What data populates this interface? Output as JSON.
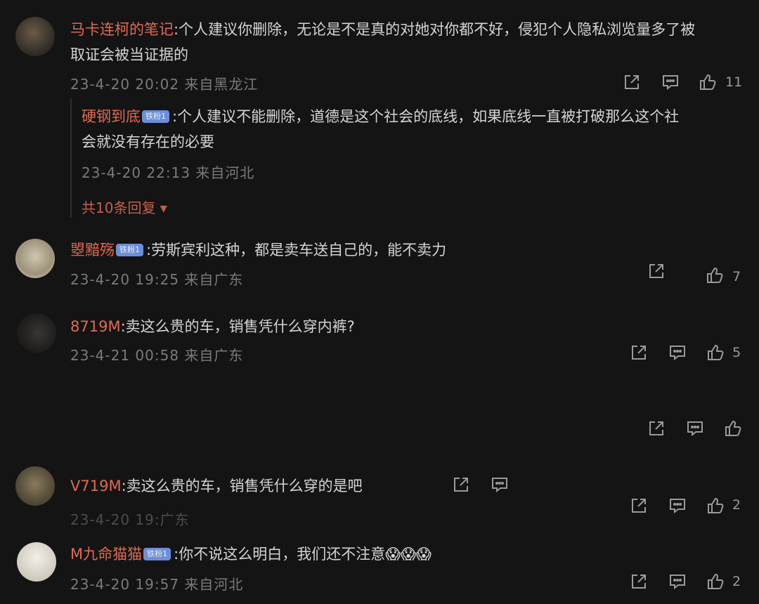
{
  "comments": [
    {
      "user": "马卡连柯的笔记",
      "text_line1": ":个人建议你删除，无论是不是真的对她对你都不好，侵犯个人隐私浏览量多了被",
      "text_line2": "取证会被当证据的",
      "meta": "23-4-20 20:02 来自黑龙江",
      "likes": "11",
      "reply": {
        "user": "硬钢到底",
        "badge": "铁粉1",
        "text_line1": ":个人建议不能删除，道德是这个社会的底线，如果底线一直被打破那么这个社",
        "text_line2": "会就没有存在的必要",
        "meta": "23-4-20 22:13 来自河北"
      },
      "expand_label": "共10条回复 ▾"
    },
    {
      "user": "曌黯殇",
      "badge": "铁粉1",
      "text": ":劳斯宾利这种，都是卖车送自己的，能不卖力",
      "meta": "23-4-20 19:25 来自广东",
      "likes": "7"
    },
    {
      "user": "8719M",
      "text": ":卖这么贵的车，销售凭什么穿内裤?",
      "meta": "23-4-21 00:58 来自广东",
      "likes": "5"
    },
    {
      "user": "V719M",
      "text": ":卖这么贵的车，销售凭什么穿",
      "text_tail": "的是吧",
      "meta": "23-4-20 19:广东",
      "likes": "2"
    },
    {
      "user": "M九命猫猫",
      "badge": "铁粉1",
      "text": ":你不说这么明白，我们还不注意",
      "emojis": "😱😱😱",
      "meta": "23-4-20 19:57 来自河北",
      "likes": "2"
    }
  ],
  "icons": [
    "share-icon",
    "comment-icon",
    "like-icon"
  ]
}
